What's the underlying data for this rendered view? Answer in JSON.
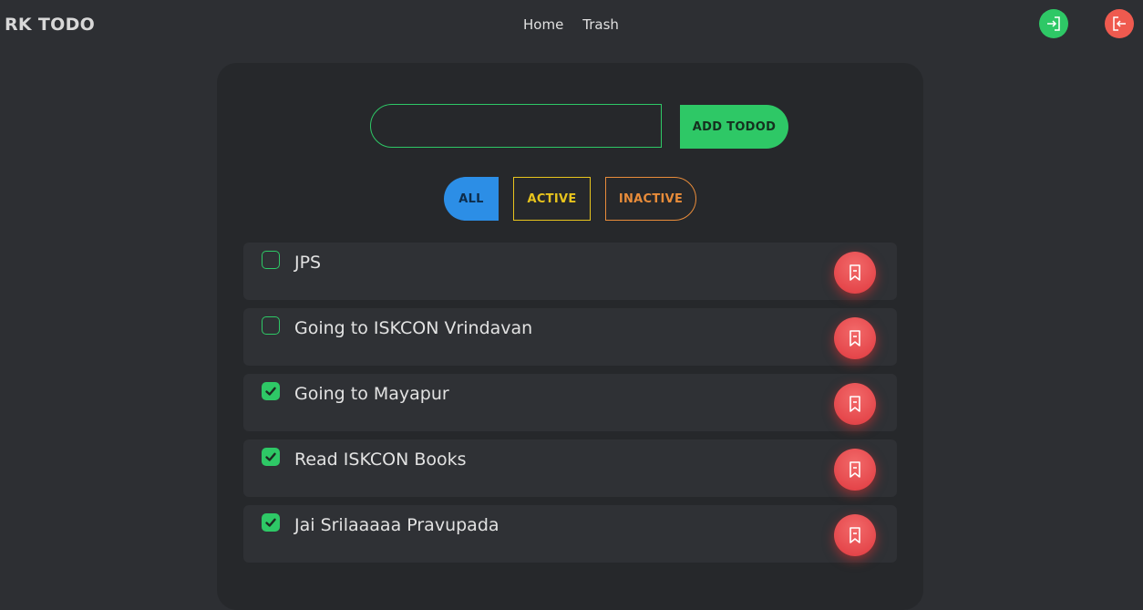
{
  "nav": {
    "brand": "RK TODO",
    "links": [
      "Home",
      "Trash"
    ],
    "login_icon": "login-icon",
    "logout_icon": "logout-icon",
    "colors": {
      "login": "#2ec866",
      "logout": "#ef5a4f"
    }
  },
  "add": {
    "input_value": "",
    "button_label": "ADD TODOD"
  },
  "filters": {
    "all": "ALL",
    "active": "ACTIVE",
    "inactive": "INACTIVE",
    "selected": "ALL"
  },
  "todos": [
    {
      "text": "JPS",
      "done": false
    },
    {
      "text": "Going to ISKCON Vrindavan",
      "done": false
    },
    {
      "text": "Going to Mayapur",
      "done": true
    },
    {
      "text": "Read ISKCON Books",
      "done": true
    },
    {
      "text": "Jai Srilaaaaa Pravupada",
      "done": true
    }
  ],
  "icons": {
    "delete": "bookmark-remove-icon",
    "checked": "checkbox-checked-icon",
    "unchecked": "checkbox-unchecked-icon"
  }
}
